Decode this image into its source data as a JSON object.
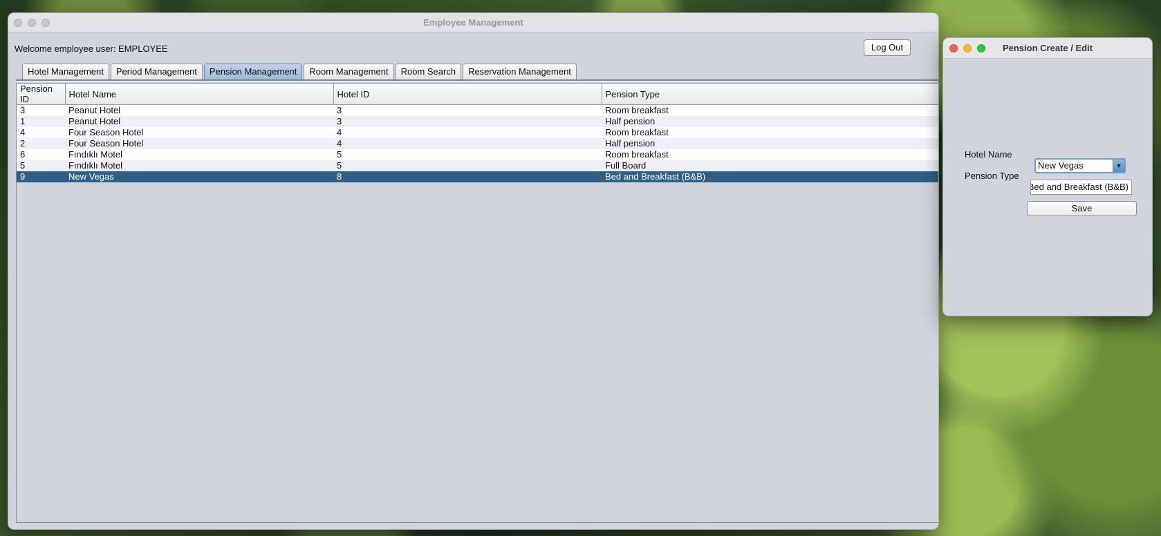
{
  "main_window": {
    "title": "Employee Management",
    "welcome": "Welcome employee user: EMPLOYEE",
    "logout_label": "Log Out",
    "tabs": [
      {
        "label": "Hotel Management"
      },
      {
        "label": "Period Management"
      },
      {
        "label": "Pension Management",
        "active": true
      },
      {
        "label": "Room Management"
      },
      {
        "label": "Room Search"
      },
      {
        "label": "Reservation Management"
      }
    ],
    "table": {
      "columns": [
        "Pension ID",
        "Hotel Name",
        "Hotel ID",
        "Pension Type"
      ],
      "rows": [
        [
          "3",
          "Peanut Hotel",
          "3",
          "Room breakfast"
        ],
        [
          "1",
          "Peanut Hotel",
          "3",
          "Half pension"
        ],
        [
          "4",
          "Four Season Hotel",
          "4",
          "Room breakfast"
        ],
        [
          "2",
          "Four Season Hotel",
          "4",
          "Half pension"
        ],
        [
          "6",
          "Fındıklı Motel",
          "5",
          "Room breakfast"
        ],
        [
          "5",
          "Fındıklı Motel",
          "5",
          "Full Board"
        ],
        [
          "9",
          "New Vegas",
          "8",
          "Bed and Breakfast (B&B)"
        ]
      ],
      "selected_row_index": 6
    }
  },
  "dialog": {
    "title": "Pension Create / Edit",
    "hotel_name_label": "Hotel Name",
    "hotel_name_value": "New Vegas",
    "pension_type_label": "Pension Type",
    "pension_type_value": "Bed and Breakfast (B&B)",
    "save_label": "Save"
  },
  "colors": {
    "selection": "#2f5f86",
    "active_tab": "#a3bad4",
    "window_bg": "#d0d4dc"
  }
}
